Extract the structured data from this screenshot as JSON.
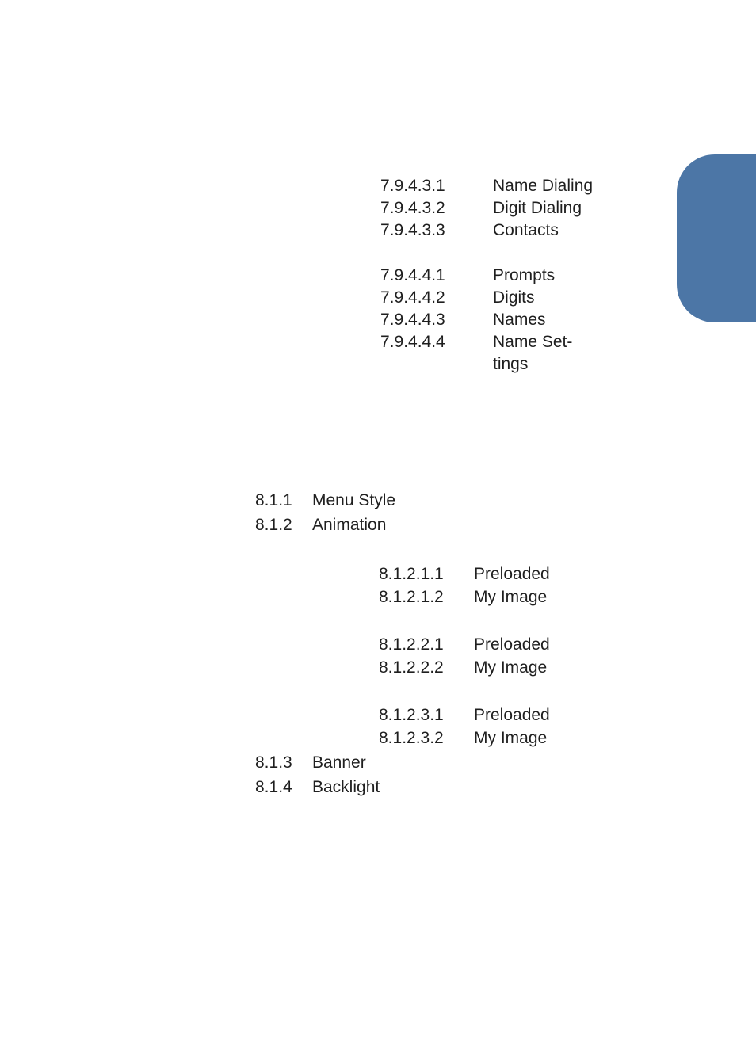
{
  "block1": [
    {
      "num": "7.9.4.3.1",
      "txt": "Name Dialing"
    },
    {
      "num": "7.9.4.3.2",
      "txt": "Digit Dialing"
    },
    {
      "num": "7.9.4.3.3",
      "txt": "Contacts"
    }
  ],
  "block2": [
    {
      "num": "7.9.4.4.1",
      "txt": "Prompts"
    },
    {
      "num": "7.9.4.4.2",
      "txt": "Digits"
    },
    {
      "num": "7.9.4.4.3",
      "txt": "Names"
    },
    {
      "num": "7.9.4.4.4",
      "txt": "Name Set-"
    }
  ],
  "block2_tail": "tings",
  "mid": [
    {
      "num": "8.1.1",
      "txt": "Menu Style"
    },
    {
      "num": "8.1.2",
      "txt": "Animation"
    }
  ],
  "block3": [
    {
      "num": "8.1.2.1.1",
      "txt": "Preloaded"
    },
    {
      "num": "8.1.2.1.2",
      "txt": "My Image"
    }
  ],
  "block4": [
    {
      "num": "8.1.2.2.1",
      "txt": "Preloaded"
    },
    {
      "num": "8.1.2.2.2",
      "txt": "My Image"
    }
  ],
  "block5": [
    {
      "num": "8.1.2.3.1",
      "txt": "Preloaded"
    },
    {
      "num": "8.1.2.3.2",
      "txt": "My Image"
    }
  ],
  "bottom": [
    {
      "num": "8.1.3",
      "txt": "Banner"
    },
    {
      "num": "8.1.4",
      "txt": "Backlight"
    }
  ]
}
